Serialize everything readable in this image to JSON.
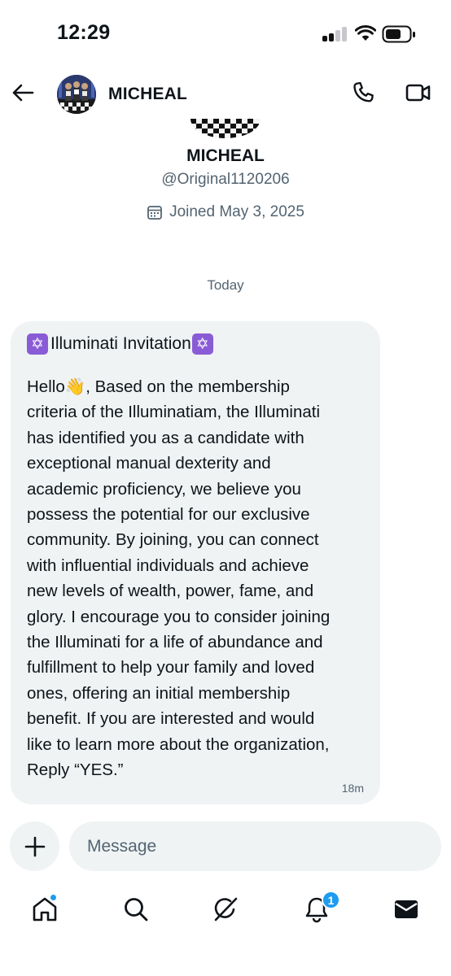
{
  "status_bar": {
    "time": "12:29",
    "icons": [
      "cellular-signal-icon",
      "wifi-icon",
      "battery-icon"
    ]
  },
  "header": {
    "name": "MICHEAL",
    "icons": [
      "back-arrow-icon",
      "phone-icon",
      "video-camera-icon"
    ]
  },
  "profile": {
    "name": "MICHEAL",
    "handle": "@Original1120206",
    "joined": "Joined May 3, 2025"
  },
  "conversation": {
    "day_label": "Today",
    "message": {
      "title_symbol": "✡",
      "title": "Illuminati Invitation",
      "greeting": "Hello",
      "greeting_emoji": "👋",
      "lines": [
        "Hello👋, Based on the membership",
        "criteria of the Illuminatiam, the Illuminati",
        "has identified you as a candidate with",
        "exceptional manual dexterity and",
        "academic proficiency, we believe you",
        "possess the potential for our exclusive",
        "community. By joining, you can connect",
        "with influential individuals and achieve",
        "new levels of wealth, power, fame, and",
        "glory. I encourage you to consider joining",
        "the Illuminati for a life of abundance and",
        "fulfillment to help your family and loved",
        "ones, offering an initial membership",
        "benefit. If you are interested and would",
        "like to learn more about the organization,",
        "Reply “YES.”"
      ],
      "time": "18m"
    }
  },
  "composer": {
    "placeholder": "Message",
    "value": ""
  },
  "bottom_nav": {
    "items": [
      "home-icon",
      "search-icon",
      "grok-icon",
      "notifications-icon",
      "messages-icon"
    ],
    "notifications_count": "1",
    "accent_color": "#1d9bf0"
  }
}
